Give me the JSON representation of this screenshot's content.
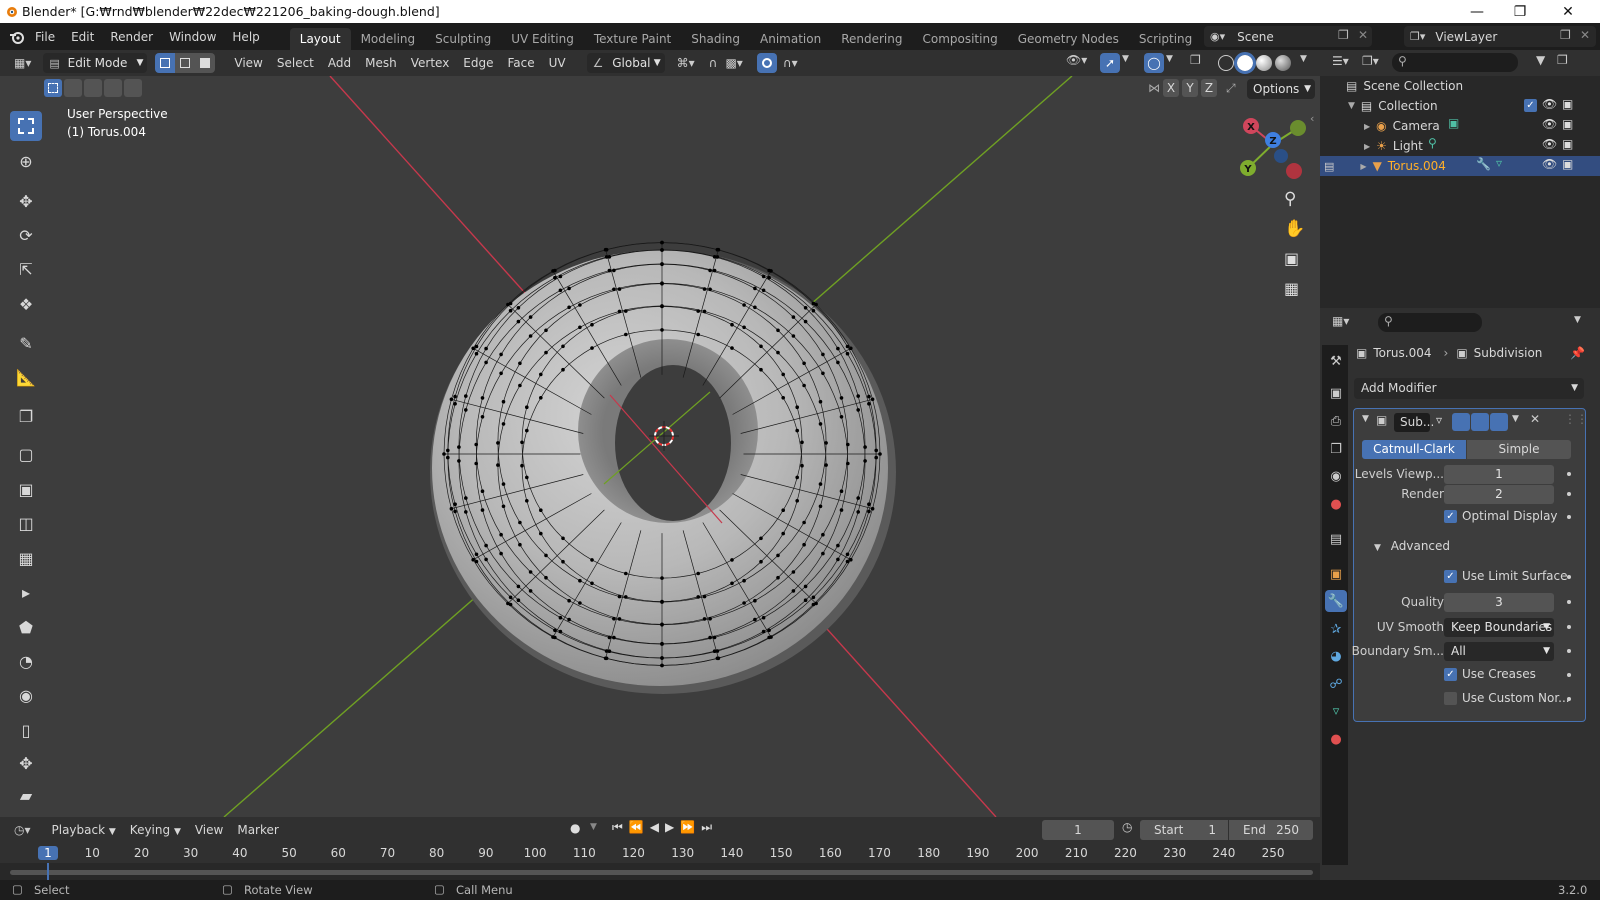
{
  "window": {
    "title": "Blender* [G:₩rnd₩blender₩22dec₩221206_baking-dough.blend]",
    "minimize_glyph": "—",
    "maximize_glyph": "❐",
    "close_glyph": "✕"
  },
  "menu": [
    "File",
    "Edit",
    "Render",
    "Window",
    "Help"
  ],
  "workspaces": [
    "Layout",
    "Modeling",
    "Sculpting",
    "UV Editing",
    "Texture Paint",
    "Shading",
    "Animation",
    "Rendering",
    "Compositing",
    "Geometry Nodes",
    "Scripting"
  ],
  "active_workspace": "Layout",
  "add_workspace_glyph": "+",
  "scene": {
    "name": "Scene"
  },
  "view_layer": {
    "name": "ViewLayer"
  },
  "viewport_header": {
    "mode": "Edit Mode",
    "menus": [
      "View",
      "Select",
      "Add",
      "Mesh",
      "Vertex",
      "Edge",
      "Face",
      "UV"
    ],
    "transform_orientation": "Global",
    "options_label": "Options",
    "axis_x": "X",
    "axis_y": "Y",
    "axis_z": "Z"
  },
  "viewport": {
    "perspective_label": "User Perspective",
    "object_label": "(1) Torus.004",
    "gizmo_x": "X",
    "gizmo_y": "Y",
    "gizmo_z": "Z"
  },
  "outliner": {
    "root": "Scene Collection",
    "collection": "Collection",
    "items": [
      {
        "name": "Camera",
        "selected": false
      },
      {
        "name": "Light",
        "selected": false
      },
      {
        "name": "Torus.004",
        "selected": true
      }
    ]
  },
  "properties": {
    "breadcrumb_object": "Torus.004",
    "breadcrumb_modifier": "Subdivision",
    "add_modifier": "Add Modifier",
    "modifier_short_name": "Sub...",
    "subdiv_types": [
      "Catmull-Clark",
      "Simple"
    ],
    "active_subdiv_type": "Catmull-Clark",
    "levels_viewport_label": "Levels Viewp...",
    "levels_viewport": "1",
    "render_label": "Render",
    "render_levels": "2",
    "optimal_display": "Optimal Display",
    "advanced": "Advanced",
    "use_limit_surface": "Use Limit Surface",
    "quality_label": "Quality",
    "quality": "3",
    "uv_smooth_label": "UV Smooth",
    "uv_smooth": "Keep Boundaries",
    "boundary_smooth_label": "Boundary Sm...",
    "boundary_smooth": "All",
    "use_creases": "Use Creases",
    "use_custom_normals": "Use Custom Nor..."
  },
  "timeline": {
    "menus": [
      "Playback",
      "Keying",
      "View",
      "Marker"
    ],
    "current_frame": "1",
    "start_label": "Start",
    "start": "1",
    "end_label": "End",
    "end": "250",
    "ruler": [
      "1",
      "10",
      "20",
      "30",
      "40",
      "50",
      "60",
      "70",
      "80",
      "90",
      "100",
      "110",
      "120",
      "130",
      "140",
      "150",
      "160",
      "170",
      "180",
      "190",
      "200",
      "210",
      "220",
      "230",
      "240",
      "250"
    ]
  },
  "statusbar": {
    "select": "Select",
    "rotate": "Rotate View",
    "call_menu": "Call Menu",
    "version": "3.2.0"
  },
  "colors": {
    "accent": "#4772b3",
    "x_axis": "#d0465c",
    "y_axis": "#7fad2e",
    "z_axis": "#3f7fe0",
    "viewport_bg": "#3d3d3d",
    "selected_row": "#334d80"
  }
}
